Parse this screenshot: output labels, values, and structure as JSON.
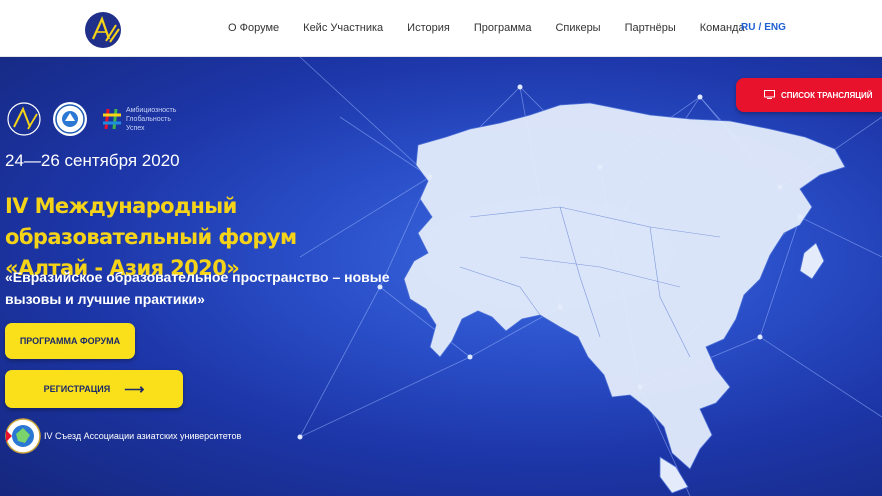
{
  "nav": {
    "items": [
      {
        "label": "О Форуме"
      },
      {
        "label": "Кейс Участника"
      },
      {
        "label": "История"
      },
      {
        "label": "Программа"
      },
      {
        "label": "Спикеры"
      },
      {
        "label": "Партнёры"
      },
      {
        "label": "Команда"
      }
    ],
    "lang": {
      "ru": "RU",
      "sep": "/",
      "en": "ENG"
    }
  },
  "hero": {
    "tagline": [
      "Амбициозность",
      "Глобальность",
      "Успех"
    ],
    "dates": "24—26 сентября 2020",
    "headline": "IV Международный образовательный форум «Алтай - Азия 2020»",
    "subhead": "«Евразийское образовательное пространство – новые вызовы и лучшие практики»",
    "program_button": "ПРОГРАММА ФОРУМА",
    "register_button": "РЕГИСТРАЦИЯ",
    "register_arrow": "⟶",
    "congress_text": "IV Съезд Ассоциации азиатских университетов",
    "stream_button": "СПИСОК ТРАНСЛЯЦИЙ"
  },
  "colors": {
    "accent_yellow": "#f9e01a",
    "headline_yellow": "#f4d318",
    "stream_red": "#e8122d",
    "hero_blue": "#2a4fc9",
    "nav_link_blue": "#1e5fd1"
  }
}
